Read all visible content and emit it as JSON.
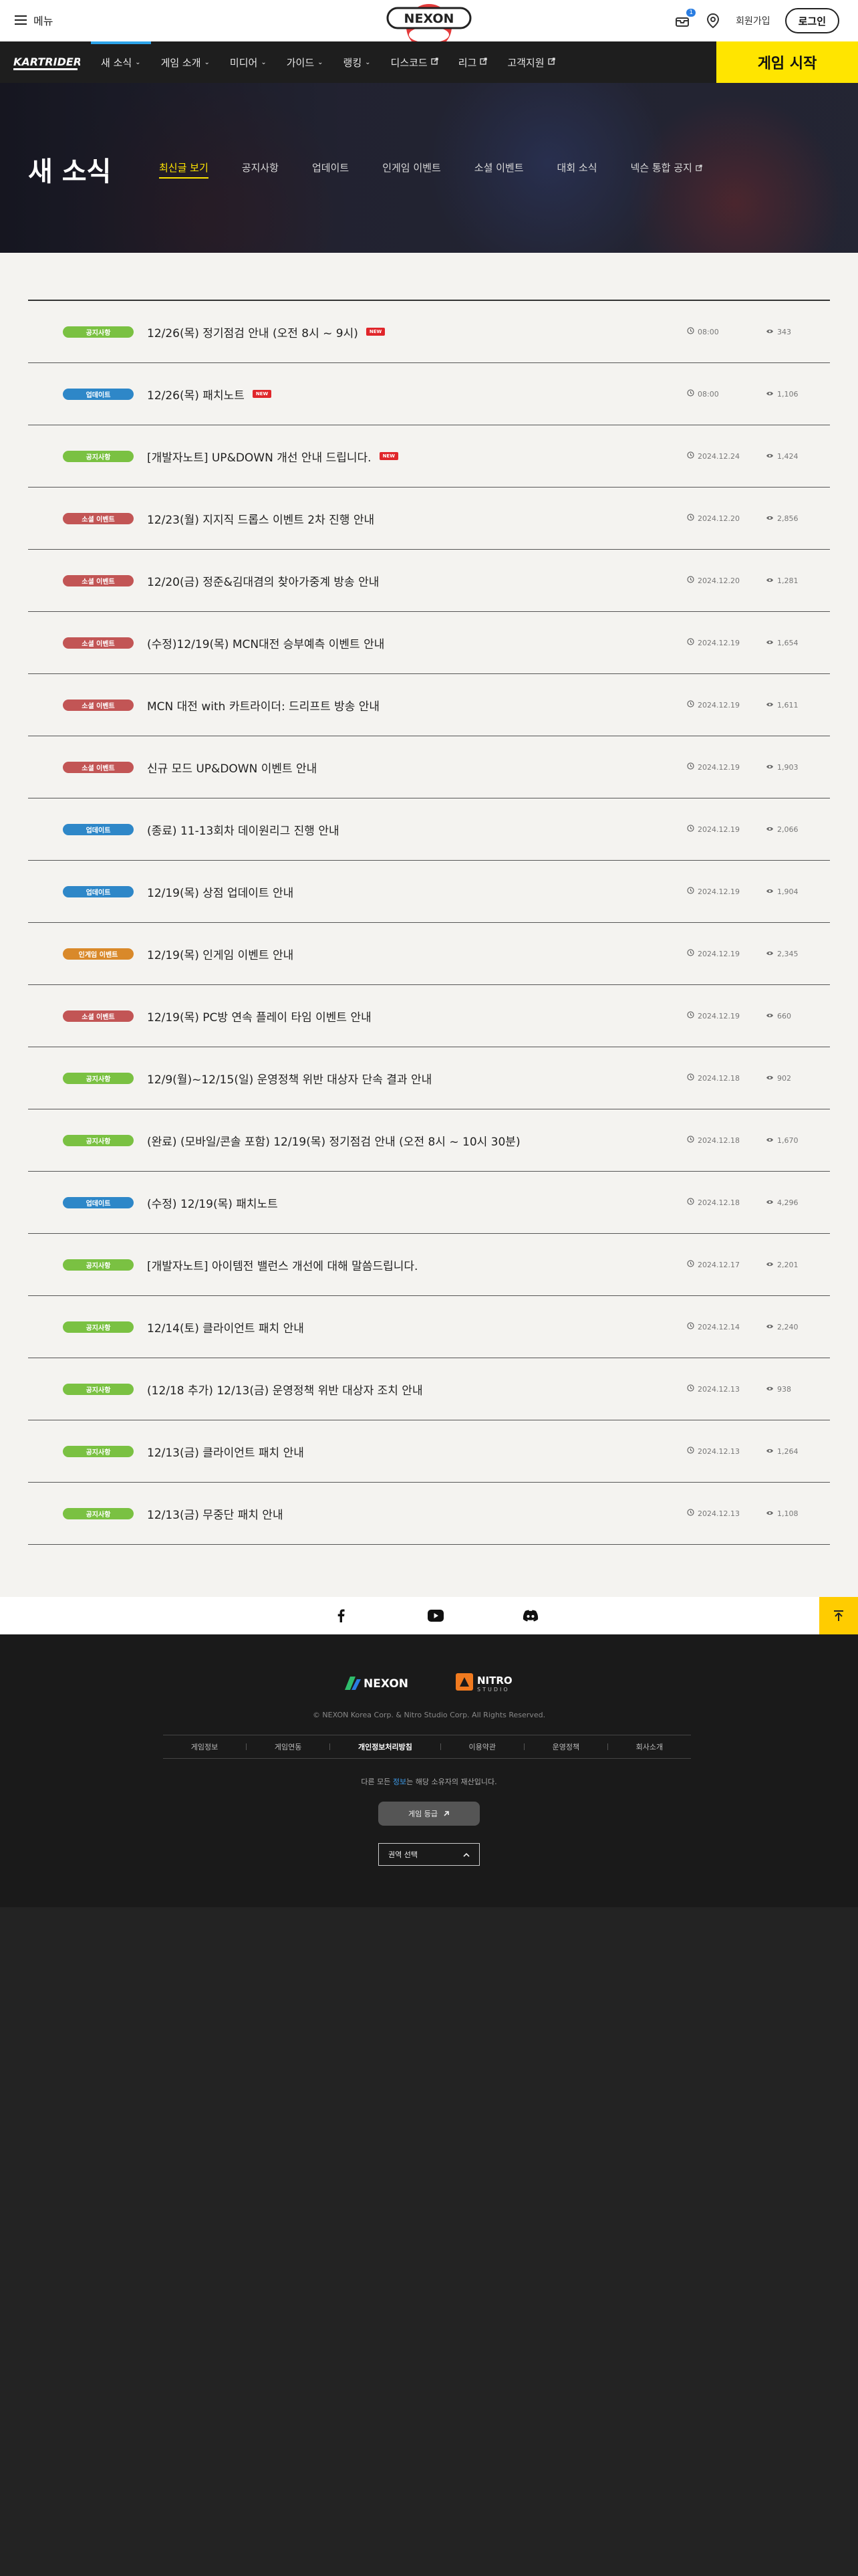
{
  "topbar": {
    "menu_label": "메뉴",
    "brand": "NEXON",
    "notification_count": "1",
    "join_label": "회원가입",
    "login_label": "로그인"
  },
  "nav": {
    "logo": "KARTRIDER",
    "items": [
      {
        "label": "새 소식",
        "suffix": "caret",
        "active": true
      },
      {
        "label": "게임 소개",
        "suffix": "caret"
      },
      {
        "label": "미디어",
        "suffix": "caret"
      },
      {
        "label": "가이드",
        "suffix": "caret"
      },
      {
        "label": "랭킹",
        "suffix": "caret"
      },
      {
        "label": "디스코드",
        "suffix": "external"
      },
      {
        "label": "리그",
        "suffix": "external"
      },
      {
        "label": "고객지원",
        "suffix": "external"
      }
    ],
    "game_start_label": "게임 시작"
  },
  "hero": {
    "title": "새 소식",
    "tabs": [
      {
        "label": "최신글 보기",
        "active": true
      },
      {
        "label": "공지사항"
      },
      {
        "label": "업데이트"
      },
      {
        "label": "인게임 이벤트"
      },
      {
        "label": "소셜 이벤트"
      },
      {
        "label": "대회 소식"
      },
      {
        "label": "넥슨 통합 공지",
        "external": true
      }
    ]
  },
  "categories": {
    "notice": "공지사항",
    "update": "업데이트",
    "social": "소셜 이벤트",
    "ingame": "인게임 이벤트"
  },
  "new_tag": "NEW",
  "posts": [
    {
      "category": "notice",
      "title": "12/26(목) 정기점검 안내 (오전 8시 ~ 9시)",
      "new": true,
      "date": "08:00",
      "views": "343"
    },
    {
      "category": "update",
      "title": "12/26(목) 패치노트",
      "new": true,
      "date": "08:00",
      "views": "1,106"
    },
    {
      "category": "notice",
      "title": "[개발자노트] UP&DOWN 개선 안내 드립니다.",
      "new": true,
      "date": "2024.12.24",
      "views": "1,424"
    },
    {
      "category": "social",
      "title": "12/23(월) 지지직 드롭스 이벤트 2차 진행 안내",
      "new": false,
      "date": "2024.12.20",
      "views": "2,856"
    },
    {
      "category": "social",
      "title": "12/20(금) 정준&김대겸의 찾아가중계 방송 안내",
      "new": false,
      "date": "2024.12.20",
      "views": "1,281"
    },
    {
      "category": "social",
      "title": "(수정)12/19(목) MCN대전 승부예측 이벤트 안내",
      "new": false,
      "date": "2024.12.19",
      "views": "1,654"
    },
    {
      "category": "social",
      "title": "MCN 대전 with 카트라이더: 드리프트 방송 안내",
      "new": false,
      "date": "2024.12.19",
      "views": "1,611"
    },
    {
      "category": "social",
      "title": "신규 모드 UP&DOWN 이벤트 안내",
      "new": false,
      "date": "2024.12.19",
      "views": "1,903"
    },
    {
      "category": "update",
      "title": "(종료) 11-13회차 데이원리그 진행 안내",
      "new": false,
      "date": "2024.12.19",
      "views": "2,066"
    },
    {
      "category": "update",
      "title": "12/19(목) 상점 업데이트 안내",
      "new": false,
      "date": "2024.12.19",
      "views": "1,904"
    },
    {
      "category": "ingame",
      "title": "12/19(목) 인게임 이벤트 안내",
      "new": false,
      "date": "2024.12.19",
      "views": "2,345"
    },
    {
      "category": "social",
      "title": "12/19(목) PC방 연속 플레이 타임 이벤트 안내",
      "new": false,
      "date": "2024.12.19",
      "views": "660"
    },
    {
      "category": "notice",
      "title": "12/9(월)~12/15(일) 운영정책 위반 대상자 단속 결과 안내",
      "new": false,
      "date": "2024.12.18",
      "views": "902"
    },
    {
      "category": "notice",
      "title": "(완료) (모바일/콘솔 포함) 12/19(목) 정기점검 안내 (오전 8시 ~ 10시 30분)",
      "new": false,
      "date": "2024.12.18",
      "views": "1,670"
    },
    {
      "category": "update",
      "title": "(수정) 12/19(목) 패치노트",
      "new": false,
      "date": "2024.12.18",
      "views": "4,296"
    },
    {
      "category": "notice",
      "title": "[개발자노트] 아이템전 밸런스 개선에 대해 말씀드립니다.",
      "new": false,
      "date": "2024.12.17",
      "views": "2,201"
    },
    {
      "category": "notice",
      "title": "12/14(토) 클라이언트 패치 안내",
      "new": false,
      "date": "2024.12.14",
      "views": "2,240"
    },
    {
      "category": "notice",
      "title": "(12/18 추가) 12/13(금) 운영정책 위반 대상자 조치 안내",
      "new": false,
      "date": "2024.12.13",
      "views": "938"
    },
    {
      "category": "notice",
      "title": "12/13(금) 클라이언트 패치 안내",
      "new": false,
      "date": "2024.12.13",
      "views": "1,264"
    },
    {
      "category": "notice",
      "title": "12/13(금) 무중단 패치 안내",
      "new": false,
      "date": "2024.12.13",
      "views": "1,108"
    }
  ],
  "social": {
    "icons": [
      "facebook-icon",
      "youtube-icon",
      "discord-icon"
    ]
  },
  "footer": {
    "nexon_logo": "NEXON",
    "nitro_logo": "NITRO",
    "nitro_sub": "STUDIO",
    "copyright": "© NEXON Korea Corp. & Nitro Studio Corp. All Rights Reserved.",
    "links": [
      {
        "label": "게임정보",
        "bold": false
      },
      {
        "label": "게임연동",
        "bold": false
      },
      {
        "label": "개인정보처리방침",
        "bold": true
      },
      {
        "label": "이용약관",
        "bold": false
      },
      {
        "label": "운영정책",
        "bold": false
      },
      {
        "label": "회사소개",
        "bold": false
      }
    ],
    "rating_pre": "다른 모든 ",
    "rating_hl": "정보",
    "rating_post": "는 해당 소유자의 재산입니다.",
    "rating_btn": "게임 등급",
    "region_label": "권역 선택"
  },
  "colors": {
    "accent_yellow": "#ffe500",
    "notice": "#7ac142",
    "update": "#2e87c8",
    "social": "#c25555",
    "ingame": "#d9892a"
  }
}
